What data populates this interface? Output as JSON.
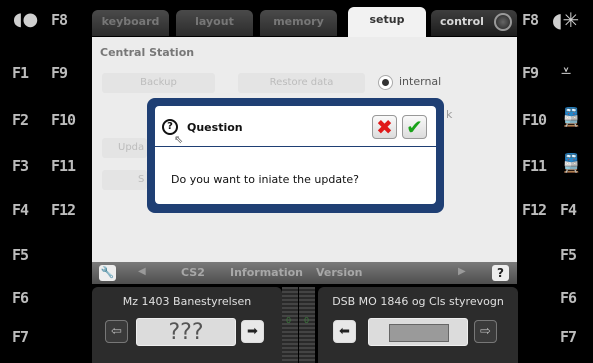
{
  "tabs": [
    {
      "label": "keyboard",
      "active": false
    },
    {
      "label": "layout",
      "active": false
    },
    {
      "label": "memory",
      "active": false
    },
    {
      "label": "setup",
      "active": true
    },
    {
      "label": "control",
      "active": false
    }
  ],
  "function_keys": {
    "left_col1": [
      "F1",
      "F2",
      "F3",
      "F4",
      "F5",
      "F6",
      "F7"
    ],
    "left_col2": [
      "F8",
      "F9",
      "F10",
      "F11",
      "F12"
    ],
    "right_col1": [
      "F8",
      "F9",
      "F10",
      "F11",
      "F12"
    ],
    "right_col2": [
      "F4",
      "F5",
      "F6",
      "F7"
    ]
  },
  "setup_panel": {
    "title": "Central Station",
    "backup_label": "Backup",
    "restore_label": "Restore data",
    "internal_label": "internal",
    "second_option_label": "k",
    "update_label": "Upda",
    "s_label": "S"
  },
  "breadcrumb": {
    "items": [
      "CS2",
      "Information",
      "Version"
    ],
    "help_label": "?"
  },
  "dialog": {
    "title": "Question",
    "message": "Do you want to iniate the update?",
    "cancel_glyph": "✖",
    "ok_glyph": "✔"
  },
  "loco_left": {
    "name": "Mz 1403 Banestyrelsen",
    "image_text": "???",
    "speed": "0"
  },
  "loco_right": {
    "name": "DSB MO 1846 og Cls styrevogn",
    "speed": "0"
  }
}
